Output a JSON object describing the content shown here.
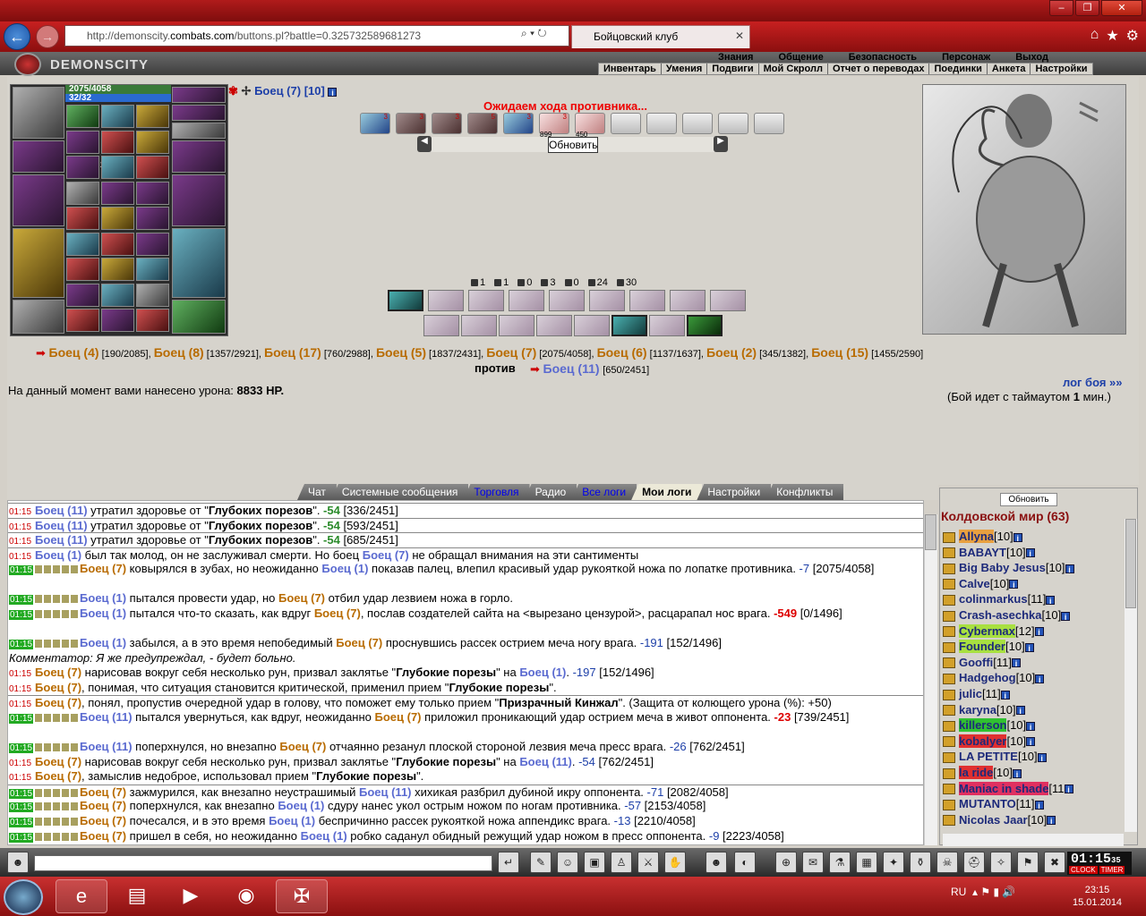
{
  "browser": {
    "url_prefix": "http://demonscity.",
    "url_domain": "combats.com",
    "url_path": "/buttons.pl?battle=0.325732589681273",
    "tab_title": "Бойцовский клуб"
  },
  "game": {
    "logo": "DEMONSCITY",
    "menu_top": [
      "Знания",
      "Общение",
      "Безопасность",
      "Персонаж",
      "Выход"
    ],
    "menu_bottom": [
      "Инвентарь",
      "Умения",
      "Подвиги",
      "Мой Скролл",
      "Отчет о переводах",
      "Поединки",
      "Анкета",
      "Настройки"
    ]
  },
  "player": {
    "hp": "2075/4058",
    "mp": "32/32",
    "counts": [
      "x9",
      "x3",
      "x1",
      "x2",
      "x1"
    ],
    "hp_fraction": 0.511
  },
  "opponent_header": {
    "name": "Боец (7)",
    "level": "[10]"
  },
  "battle": {
    "waiting": "Ожидаем хода противника...",
    "refresh": "Обновить",
    "scroll_counts": [
      "3",
      "3",
      "3",
      "5",
      "3",
      "3"
    ],
    "scroll_sub": [
      "899",
      "450"
    ],
    "stats": [
      {
        "icon": "hit-icon",
        "v": "1"
      },
      {
        "icon": "crit-icon",
        "v": "1"
      },
      {
        "icon": "counter-icon",
        "v": "0"
      },
      {
        "icon": "block-icon",
        "v": "3"
      },
      {
        "icon": "parry-icon",
        "v": "0"
      },
      {
        "icon": "heart-icon",
        "v": "24"
      },
      {
        "icon": "spirit-icon",
        "v": "30"
      }
    ]
  },
  "teams": {
    "allies": [
      {
        "name": "Боец (4)",
        "hp": "[190/2085]"
      },
      {
        "name": "Боец (8)",
        "hp": "[1357/2921]"
      },
      {
        "name": "Боец (17)",
        "hp": "[760/2988]"
      },
      {
        "name": "Боец (5)",
        "hp": "[1837/2431]"
      },
      {
        "name": "Боец (7)",
        "hp": "[2075/4058]"
      },
      {
        "name": "Боец (6)",
        "hp": "[1137/1637]"
      },
      {
        "name": "Боец (2)",
        "hp": "[345/1382]"
      },
      {
        "name": "Боец (15)",
        "hp": "[1455/2590]"
      }
    ],
    "versus": "против",
    "enemy": {
      "name": "Боец (11)",
      "hp": "[650/2451]"
    }
  },
  "damage_text": "На данный момент вами нанесено урона:",
  "damage_value": "8833 HP.",
  "log_link": "лог боя »»",
  "timeout_a": "(Бой идет с таймаутом",
  "timeout_b": "1",
  "timeout_c": "мин.)",
  "chat_tabs": [
    {
      "label": "Чат",
      "style": ""
    },
    {
      "label": "Системные сообщения",
      "style": ""
    },
    {
      "label": "Торговля",
      "style": "blue"
    },
    {
      "label": "Радио",
      "style": ""
    },
    {
      "label": "Все логи",
      "style": "blue"
    },
    {
      "label": "Мои логи",
      "style": "active"
    },
    {
      "label": "Настройки",
      "style": ""
    },
    {
      "label": "Конфликты",
      "style": ""
    }
  ],
  "chat_lines": [
    {
      "t": "01:15",
      "html": "<span class='nb'>Боец (11)</span> утратил здоровье от \"<b>Глубоких порезов</b>\". <span class='dmgg'>-54</span> [336/2451]",
      "sep": true
    },
    {
      "t": "01:15",
      "html": "<span class='nb'>Боец (11)</span> утратил здоровье от \"<b>Глубоких порезов</b>\". <span class='dmgg'>-54</span> [593/2451]",
      "sep": true
    },
    {
      "t": "01:15",
      "html": "<span class='nb'>Боец (11)</span> утратил здоровье от \"<b>Глубоких порезов</b>\". <span class='dmgg'>-54</span> [685/2451]",
      "sep": true
    },
    {
      "t": "01:15",
      "html": "<span class='nb'>Боец (1)</span> был так молод, он не заслуживал смерти. Но боец <span class='nb'>Боец (7)</span> не обращал внимания на эти сантименты",
      "sep": true
    },
    {
      "t": "01:15",
      "g": true,
      "html": "<span class='no'>Боец (7)</span> ковырялся в зубах, но неожиданно <span class='nb'>Боец (1)</span> показав палец, влепил красивый удар рукояткой ножа по лопатке противника. <span class='dmgv'>-7</span> [2075/4058]",
      "two": true
    },
    {
      "t": "01:15",
      "g": true,
      "html": "<span class='nb'>Боец (1)</span> пытался провести удар, но <span class='no'>Боец (7)</span> отбил удар лезвием ножа в горло."
    },
    {
      "t": "01:15",
      "g": true,
      "html": "<span class='nb'>Боец (1)</span> пытался что-то сказать, как вдруг <span class='no'>Боец (7)</span>, послав создателей сайта на &lt;вырезано цензурой&gt;, расцарапал нос врага. <span class='dmgr'>-549</span> [0/1496]",
      "two": true
    },
    {
      "t": "01:15",
      "g": true,
      "html": "<span class='nb'>Боец (1)</span> забылся, а в это время непобедимый <span class='no'>Боец (7)</span> проснувшись рассек острием меча ногу врага. <span class='dmgv'>-191</span> [152/1496]"
    },
    {
      "t": "",
      "html": "<i>Комментатор: Я же предупреждал, - будет больно.</i>"
    },
    {
      "t": "01:15",
      "html": "<span class='no'>Боец (7)</span> нарисовав вокруг себя несколько рун, призвал заклятье \"<b>Глубокие порезы</b>\" на <span class='nb'>Боец (1)</span>. <span class='dmgv'>-197</span> [152/1496]"
    },
    {
      "t": "01:15",
      "html": "<span class='no'>Боец (7)</span>, понимая, что ситуация становится критической, применил прием \"<b>Глубокие порезы</b>\"."
    },
    {
      "t": "01:15",
      "html": "<span class='no'>Боец (7)</span>, понял, пропустив очередной удар в голову, что поможет ему только прием \"<b>Призрачный Кинжал</b>\". (Защита от колющего урона (%): +50)",
      "sep": true
    },
    {
      "t": "01:15",
      "g": true,
      "html": "<span class='nb'>Боец (11)</span> пытался увернуться, как вдруг, неожиданно <span class='no'>Боец (7)</span> приложил проникающий удар острием меча в живот оппонента. <span class='dmgr'>-23</span> [739/2451]",
      "two": true
    },
    {
      "t": "01:15",
      "g": true,
      "html": "<span class='nb'>Боец (11)</span> поперхнулся, но внезапно <span class='no'>Боец (7)</span> отчаянно резанул плоской стороной лезвия меча пресс врага. <span class='dmgv'>-26</span> [762/2451]"
    },
    {
      "t": "01:15",
      "html": "<span class='no'>Боец (7)</span> нарисовав вокруг себя несколько рун, призвал заклятье \"<b>Глубокие порезы</b>\" на <span class='nb'>Боец (11)</span>. <span class='dmgv'>-54</span> [762/2451]"
    },
    {
      "t": "01:15",
      "html": "<span class='no'>Боец (7)</span>, замыслив недоброе, использовал прием \"<b>Глубокие порезы</b>\"."
    },
    {
      "t": "01:15",
      "g": true,
      "html": "<span class='no'>Боец (7)</span> зажмурился, как внезапно неустрашимый <span class='nb'>Боец (11)</span> хихикая разбрил дубиной икру оппонента. <span class='dmgv'>-71</span> [2082/4058]",
      "sep": true
    },
    {
      "t": "01:15",
      "g": true,
      "html": "<span class='no'>Боец (7)</span> поперхнулся, как внезапно <span class='nb'>Боец (1)</span> сдуру нанес укол острым ножом по ногам противника. <span class='dmgv'>-57</span> [2153/4058]"
    },
    {
      "t": "01:15",
      "g": true,
      "html": "<span class='no'>Боец (7)</span> почесался, и в это время <span class='nb'>Боец (1)</span> беспричинно рассек рукояткой ножа аппендикс врага. <span class='dmgv'>-13</span> [2210/4058]"
    },
    {
      "t": "01:15",
      "g": true,
      "html": "<span class='no'>Боец (7)</span> пришел в себя, но неожиданно <span class='nb'>Боец (1)</span> робко саданул обидный режущий удар ножом в пресс оппонента. <span class='dmgv'>-9</span> [2223/4058]"
    }
  ],
  "room": {
    "refresh": "Обновить",
    "title": "Колдовской мир (63)",
    "players": [
      {
        "name": "Allyna",
        "lv": "[10]",
        "hl": "#e8a040"
      },
      {
        "name": "BABAYT",
        "lv": "[10]",
        "hl": ""
      },
      {
        "name": "Big Baby Jesus",
        "lv": "[10]",
        "hl": ""
      },
      {
        "name": "Calve",
        "lv": "[10]",
        "hl": ""
      },
      {
        "name": "colinmarkus",
        "lv": "[11]",
        "hl": ""
      },
      {
        "name": "Crash-asechka",
        "lv": "[10]",
        "hl": ""
      },
      {
        "name": "Cybermax",
        "lv": "[12]",
        "hl": "#a8e040"
      },
      {
        "name": "Founder",
        "lv": "[10]",
        "hl": "#a8e040"
      },
      {
        "name": "Gooffi",
        "lv": "[11]",
        "hl": ""
      },
      {
        "name": "Hadgehog",
        "lv": "[10]",
        "hl": ""
      },
      {
        "name": "julic",
        "lv": "[11]",
        "hl": ""
      },
      {
        "name": "karyna",
        "lv": "[10]",
        "hl": ""
      },
      {
        "name": "killerson",
        "lv": "[10]",
        "hl": "#30c030"
      },
      {
        "name": "kobalyer",
        "lv": "[10]",
        "hl": "#e03030"
      },
      {
        "name": "LA PETITE",
        "lv": "[10]",
        "hl": ""
      },
      {
        "name": "la ride",
        "lv": "[10]",
        "hl": "#e03030"
      },
      {
        "name": "Maniac in shade",
        "lv": "[11",
        "hl": "#e03060"
      },
      {
        "name": "MUTANTO",
        "lv": "[11]",
        "hl": ""
      },
      {
        "name": "Nicolas Jaar",
        "lv": "[10]",
        "hl": ""
      }
    ]
  },
  "clock": "01:15",
  "clock_sec": "35",
  "clock_labels": [
    "CLOCK",
    "TIMER"
  ],
  "tray": {
    "lang": "RU",
    "time": "23:15",
    "date": "15.01.2014"
  }
}
